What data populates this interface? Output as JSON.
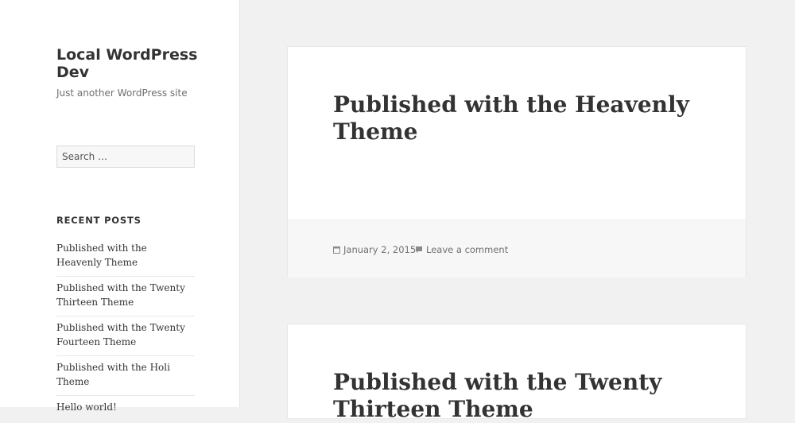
{
  "site": {
    "title": "Local WordPress Dev",
    "description": "Just another WordPress site"
  },
  "search": {
    "placeholder": "Search …"
  },
  "recent_posts": {
    "title": "RECENT POSTS",
    "items": [
      "Published with the Heavenly Theme",
      "Published with the Twenty Thirteen Theme",
      "Published with the Twenty Fourteen Theme",
      "Published with the Holi Theme",
      "Hello world!"
    ]
  },
  "posts": [
    {
      "title": "Published with the Heavenly Theme",
      "date": "January 2, 2015",
      "comment_label": "Leave a comment"
    },
    {
      "title": "Published with the Twenty Thirteen Theme"
    }
  ],
  "icons": {
    "date": "calendar-icon",
    "comment": "comment-bubble-icon"
  }
}
